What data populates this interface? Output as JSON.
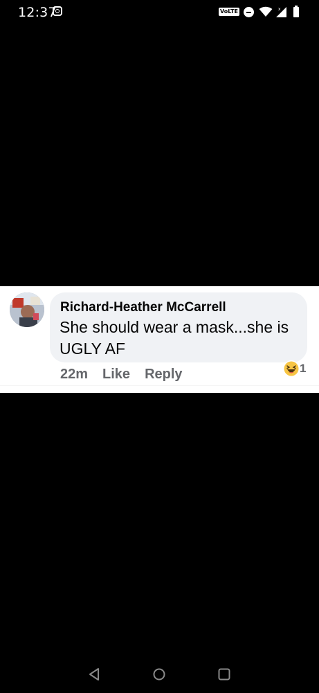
{
  "status_bar": {
    "time": "12:37",
    "volte_label": "VoLTE",
    "icons": [
      "instagram-icon",
      "volte-icon",
      "do-not-disturb-icon",
      "wifi-icon",
      "signal-icon",
      "battery-icon"
    ]
  },
  "comment": {
    "author": "Richard-Heather McCarrell",
    "text": "She should wear a mask...she is UGLY AF",
    "time": "22m",
    "like_label": "Like",
    "reply_label": "Reply",
    "reaction_icon": "haha-emoji-icon",
    "reaction_count": "1"
  },
  "nav_bar": {
    "icons": [
      "back-icon",
      "home-icon",
      "recents-icon"
    ]
  },
  "colors": {
    "background": "#000000",
    "card": "#ffffff",
    "bubble": "#f0f2f5",
    "text_primary": "#050505",
    "text_secondary": "#65676b",
    "nav_icon": "#8a8a8a"
  }
}
